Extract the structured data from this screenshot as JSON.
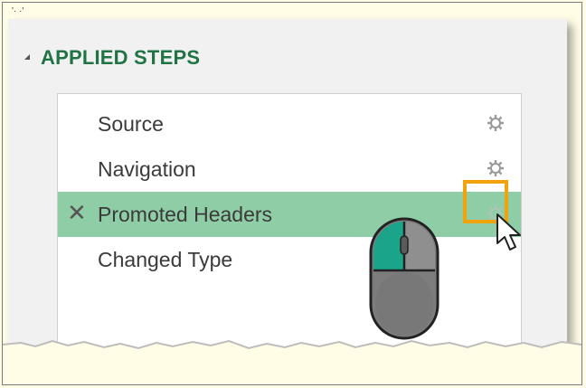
{
  "panel": {
    "section_title": "APPLIED STEPS",
    "collapse_icon": "triangle-collapse-icon"
  },
  "steps": [
    {
      "label": "Source",
      "icon": "gear-icon",
      "selected": false
    },
    {
      "label": "Navigation",
      "icon": "gear-icon",
      "selected": false
    },
    {
      "label": "Promoted Headers",
      "icon": "gear-icon",
      "selected": true,
      "delete_icon": "close-x-icon"
    },
    {
      "label": "Changed Type",
      "icon": "none",
      "selected": false
    }
  ],
  "colors": {
    "accent_title": "#217346",
    "selected_row": "#8fcda6",
    "highlight_box": "#f0a30a",
    "mouse_left_button": "#1aa48a"
  },
  "overlay": {
    "mouse_icon": "mouse-left-click-icon",
    "cursor_icon": "arrow-cursor-icon"
  }
}
